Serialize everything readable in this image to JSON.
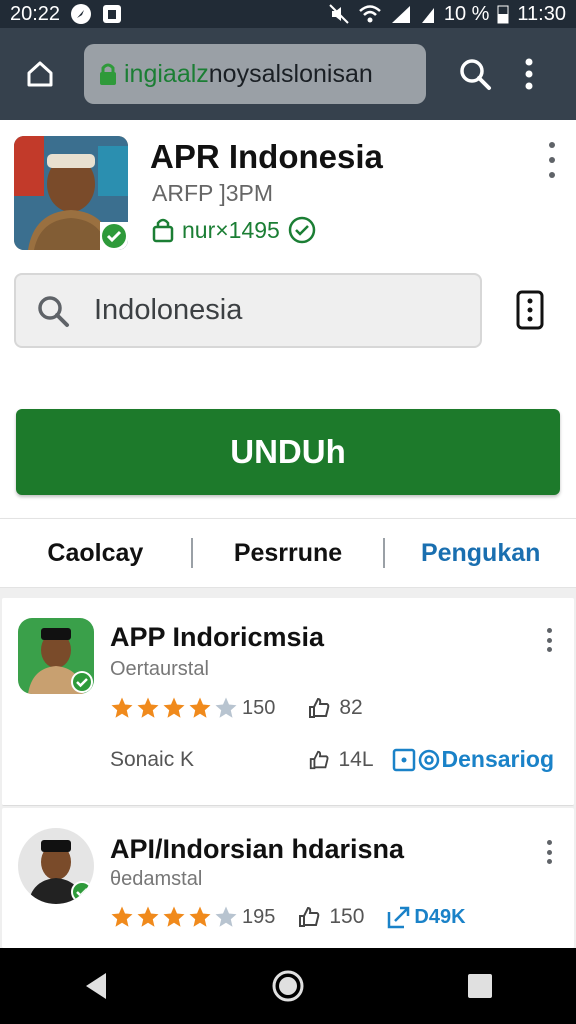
{
  "status_bar": {
    "time_left": "20:22",
    "battery": "10 %",
    "time_right": "11:30"
  },
  "browser": {
    "url_domain": "ingiaalz",
    "url_path": "noysalslonisan"
  },
  "app": {
    "title": "APR Indonesia",
    "subtitle": "ARFP ]3PM",
    "id": "nur×1495"
  },
  "search": {
    "value": "Indolonesia"
  },
  "download_label": "UNDUh",
  "tabs": [
    {
      "label": "Caolcay"
    },
    {
      "label": "Pesrrune"
    },
    {
      "label": "Pengukan"
    }
  ],
  "list": [
    {
      "title": "APP Indoricmsia",
      "subtitle": "Oertaurstal",
      "rating_value": 4,
      "rating_count": "150",
      "likes": "82",
      "footer_label": "Sonaic K",
      "footer_likes": "14L",
      "link_label": "Densariog"
    },
    {
      "title": "API/Indorsian hdarisna",
      "subtitle": "θedamstal",
      "rating_value": 4,
      "rating_count": "195",
      "likes": "150",
      "link_label": "D49K"
    }
  ],
  "colors": {
    "primary_green": "#1d7a2b",
    "link_blue": "#1a82c8",
    "star_orange": "#f08a1c"
  }
}
